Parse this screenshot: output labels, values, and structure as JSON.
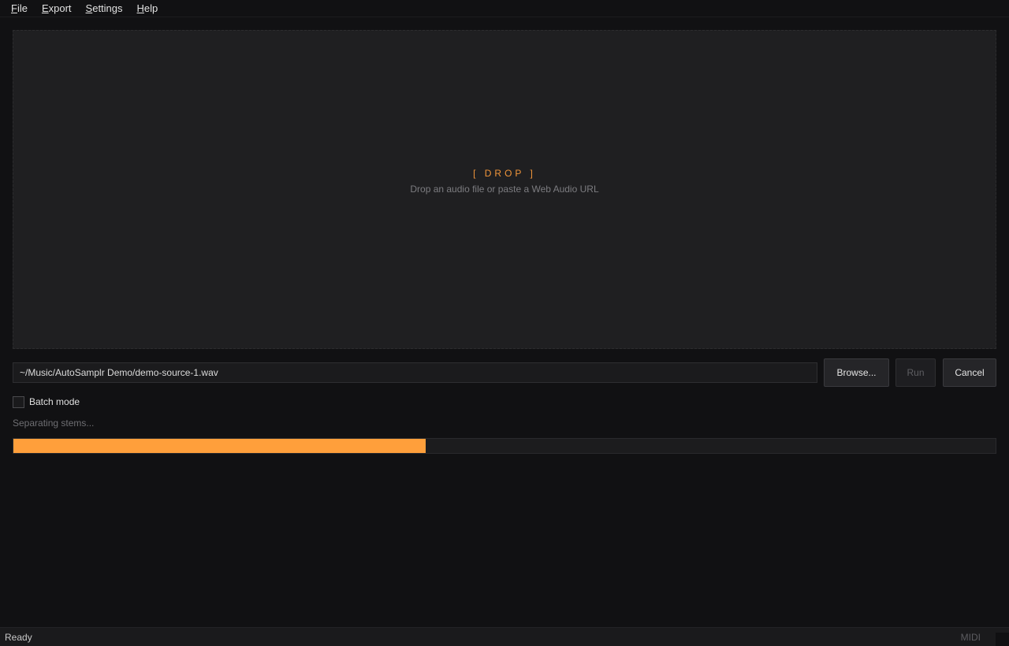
{
  "menu": {
    "items": [
      {
        "label": "File",
        "mnemonic": "F",
        "rest": "ile"
      },
      {
        "label": "Export",
        "mnemonic": "E",
        "rest": "xport"
      },
      {
        "label": "Settings",
        "mnemonic": "S",
        "rest": "ettings"
      },
      {
        "label": "Help",
        "mnemonic": "H",
        "rest": "elp"
      }
    ]
  },
  "dropzone": {
    "title": "[ DROP ]",
    "hint": "Drop an audio file or paste a Web Audio URL"
  },
  "source": {
    "path": "~/Music/AutoSamplr Demo/demo-source-1.wav"
  },
  "actions": {
    "browse_label": "Browse...",
    "run_label": "Run",
    "cancel_label": "Cancel"
  },
  "batch": {
    "label": "Batch mode",
    "checked": false
  },
  "progress": {
    "status": "Separating stems...",
    "fraction": 0.42
  },
  "statusbar": {
    "status": "Ready",
    "midi": "MIDI"
  },
  "colors": {
    "accent": "#ff9f3b",
    "background": "#111113",
    "panel": "#1f1f21"
  }
}
